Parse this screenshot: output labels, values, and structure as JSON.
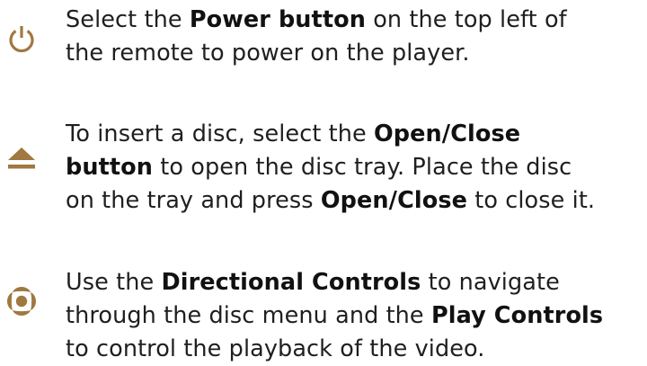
{
  "accent_color": "#a07840",
  "steps": [
    {
      "icon": "power-icon",
      "lines": [
        {
          "pre": "Select the ",
          "bold": "Power button",
          "post": " on the top left of"
        },
        {
          "pre": "the remote to power on the player."
        }
      ]
    },
    {
      "icon": "eject-icon",
      "lines": [
        {
          "pre": "To insert a disc, select the ",
          "bold": "Open/Close"
        },
        {
          "bold": "button",
          "post": " to open the disc tray. Place the disc"
        },
        {
          "pre": "on the tray and press ",
          "bold": "Open/Close",
          "post": " to close it."
        }
      ]
    },
    {
      "icon": "directional-pad-icon",
      "lines": [
        {
          "pre": "Use the ",
          "bold": "Directional Controls",
          "post": " to navigate"
        },
        {
          "pre": "through the disc menu and the ",
          "bold": "Play Controls"
        },
        {
          "pre": "to control the playback of the video."
        }
      ]
    }
  ]
}
